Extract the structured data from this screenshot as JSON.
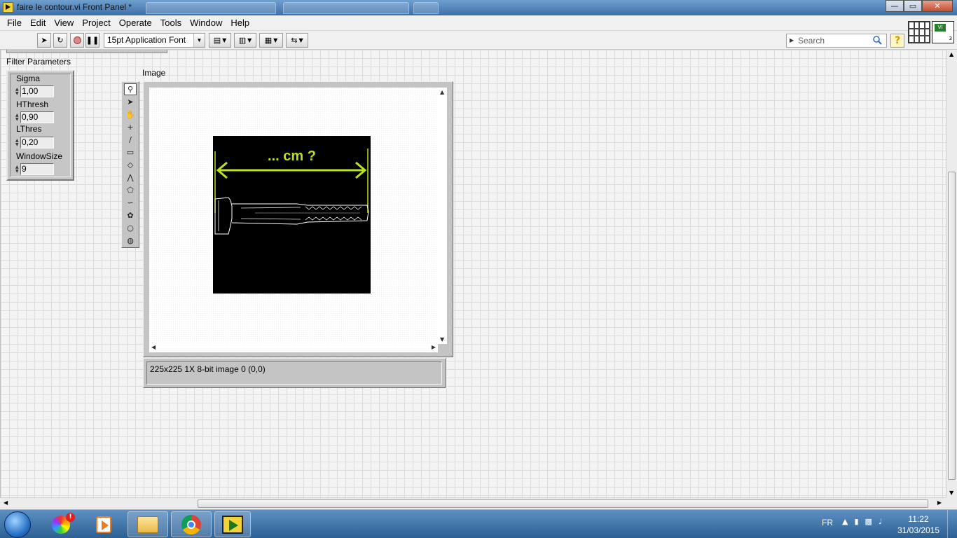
{
  "window": {
    "title": "faire le contour.vi Front Panel *"
  },
  "menubar": {
    "items": [
      "File",
      "Edit",
      "View",
      "Project",
      "Operate",
      "Tools",
      "Window",
      "Help"
    ]
  },
  "toolbar": {
    "font_label": "15pt Application Font",
    "search_placeholder": "Search",
    "help_label": "?"
  },
  "filter": {
    "title": "Filter Parameters",
    "sigma_label": "Sigma",
    "sigma_value": "1,00",
    "hthresh_label": "HThresh",
    "hthresh_value": "0,90",
    "lthres_label": "LThres",
    "lthres_value": "0,20",
    "window_label": "WindowSize",
    "window_value": "9"
  },
  "image": {
    "label": "Image",
    "overlay_text": "... cm ?",
    "status": "225x225 1X 8-bit image 0     (0,0)",
    "overlay_color": "#b8e21a"
  },
  "taskbar": {
    "language": "FR",
    "time": "11:22",
    "date": "31/03/2015"
  }
}
